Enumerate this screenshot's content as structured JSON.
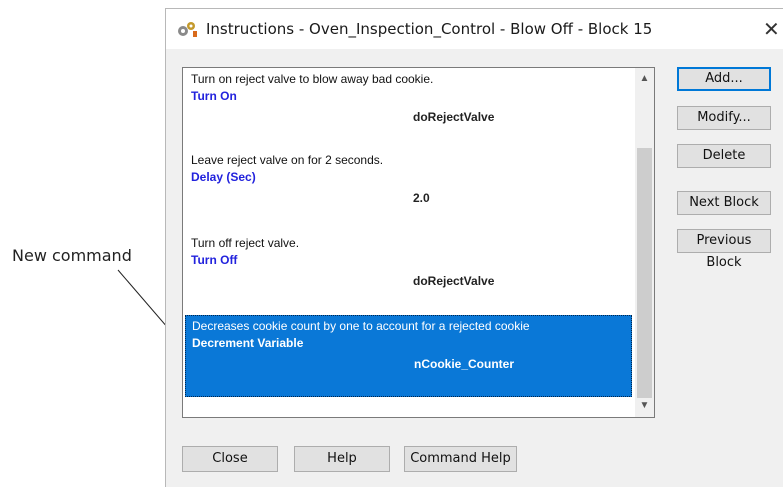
{
  "annotation": {
    "label": "New command"
  },
  "window": {
    "title": "Instructions - Oven_Inspection_Control - Blow Off - Block 15",
    "close_glyph": "✕",
    "icon": "settings-gears-icon"
  },
  "instructions": [
    {
      "comment": "Turn on reject valve to blow away bad cookie.",
      "command": "Turn On",
      "argument": "doRejectValve",
      "selected": false
    },
    {
      "comment": "Leave reject valve on for 2 seconds.",
      "command": "Delay (Sec)",
      "argument": "2.0",
      "selected": false
    },
    {
      "comment": "Turn off reject valve.",
      "command": "Turn Off",
      "argument": "doRejectValve",
      "selected": false
    },
    {
      "comment": "Decreases cookie count by one to account for a rejected cookie",
      "command": "Decrement Variable",
      "argument": "nCookie_Counter",
      "selected": true
    }
  ],
  "scrollbar": {
    "up_glyph": "▲",
    "down_glyph": "▼"
  },
  "side_buttons": {
    "add": "Add...",
    "modify": "Modify...",
    "delete": "Delete",
    "next_block": "Next Block",
    "previous_block": "Previous Block"
  },
  "bottom_buttons": {
    "close": "Close",
    "help": "Help",
    "command_help": "Command Help"
  },
  "colors": {
    "selection": "#0a78d7",
    "command_text": "#2222dd",
    "default_button_border": "#0078d7"
  }
}
